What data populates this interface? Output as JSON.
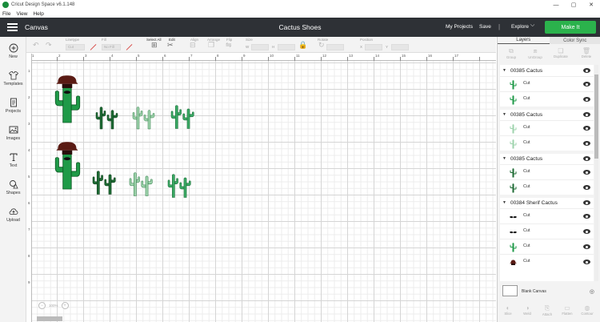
{
  "window": {
    "title": "Cricut Design Space  v6.1.148",
    "min": "—",
    "max": "▢",
    "close": "✕"
  },
  "menu": [
    "File",
    "View",
    "Help"
  ],
  "header": {
    "canvas_label": "Canvas",
    "doc_title": "Cactus Shoes",
    "my_projects": "My Projects",
    "save": "Save",
    "separator": "|",
    "explore": "Explore",
    "make_it": "Make It"
  },
  "toolbar": {
    "linetype_label": "Linetype",
    "linetype_value": "Cut",
    "fill_label": "Fill",
    "fill_value": "No Fill",
    "select_all": "Select All",
    "edit": "Edit",
    "align": "Align",
    "arrange": "Arrange",
    "flip": "Flip",
    "size": "Size",
    "w": "W",
    "h": "H",
    "rotate": "Rotate",
    "position": "Position",
    "x": "X",
    "y": "Y"
  },
  "sidebar": {
    "items": [
      {
        "label": "New",
        "icon": "plus-circle-icon"
      },
      {
        "label": "Templates",
        "icon": "shirt-icon"
      },
      {
        "label": "Projects",
        "icon": "projects-icon"
      },
      {
        "label": "Images",
        "icon": "image-icon"
      },
      {
        "label": "Text",
        "icon": "text-icon"
      },
      {
        "label": "Shapes",
        "icon": "shapes-icon"
      },
      {
        "label": "Upload",
        "icon": "cloud-upload-icon"
      }
    ]
  },
  "ruler": {
    "top": [
      "1",
      "2",
      "3",
      "4",
      "5",
      "6",
      "7",
      "8",
      "9",
      "10",
      "11",
      "12",
      "13",
      "14",
      "15",
      "16",
      "17"
    ],
    "left": [
      "1",
      "2",
      "3",
      "4",
      "5",
      "6",
      "7",
      "8",
      "9"
    ]
  },
  "zoom": {
    "minus": "−",
    "value": "100%",
    "plus": "+"
  },
  "panel": {
    "tab_layers": "Layers",
    "tab_color_sync": "Color Sync",
    "tools": [
      "Group",
      "UnGroup",
      "Duplicate",
      "Delete"
    ],
    "groups": [
      {
        "name": "00385 Cactus",
        "layers": [
          {
            "name": "Cut",
            "color": "#1f9a48"
          },
          {
            "name": "Cut",
            "color": "#1f9a48"
          }
        ]
      },
      {
        "name": "00385 Cactus",
        "layers": [
          {
            "name": "Cut",
            "color": "#9ed3ac"
          },
          {
            "name": "Cut",
            "color": "#9ed3ac"
          }
        ]
      },
      {
        "name": "00385 Cactus",
        "layers": [
          {
            "name": "Cut",
            "color": "#1e6b34"
          },
          {
            "name": "Cut",
            "color": "#1e6b34"
          }
        ]
      },
      {
        "name": "00384 Sherif Cactus",
        "layers": [
          {
            "name": "Cut",
            "color": "#111111"
          },
          {
            "name": "Cut",
            "color": "#111111"
          },
          {
            "name": "Cut",
            "color": "#1f9a48"
          },
          {
            "name": "Cut",
            "color": "#5a1b14"
          }
        ]
      }
    ],
    "blank_canvas": "Blank Canvas",
    "bottom_tools": [
      "Slice",
      "Weld",
      "Attach",
      "Flatten",
      "Contour"
    ]
  },
  "colors": {
    "header_bg": "#2e3136",
    "make_it": "#2bb24c",
    "cactus_green": "#1f9a48",
    "cactus_light": "#9ed3ac",
    "cactus_dark": "#1e6b34",
    "hat": "#5a1b14"
  }
}
